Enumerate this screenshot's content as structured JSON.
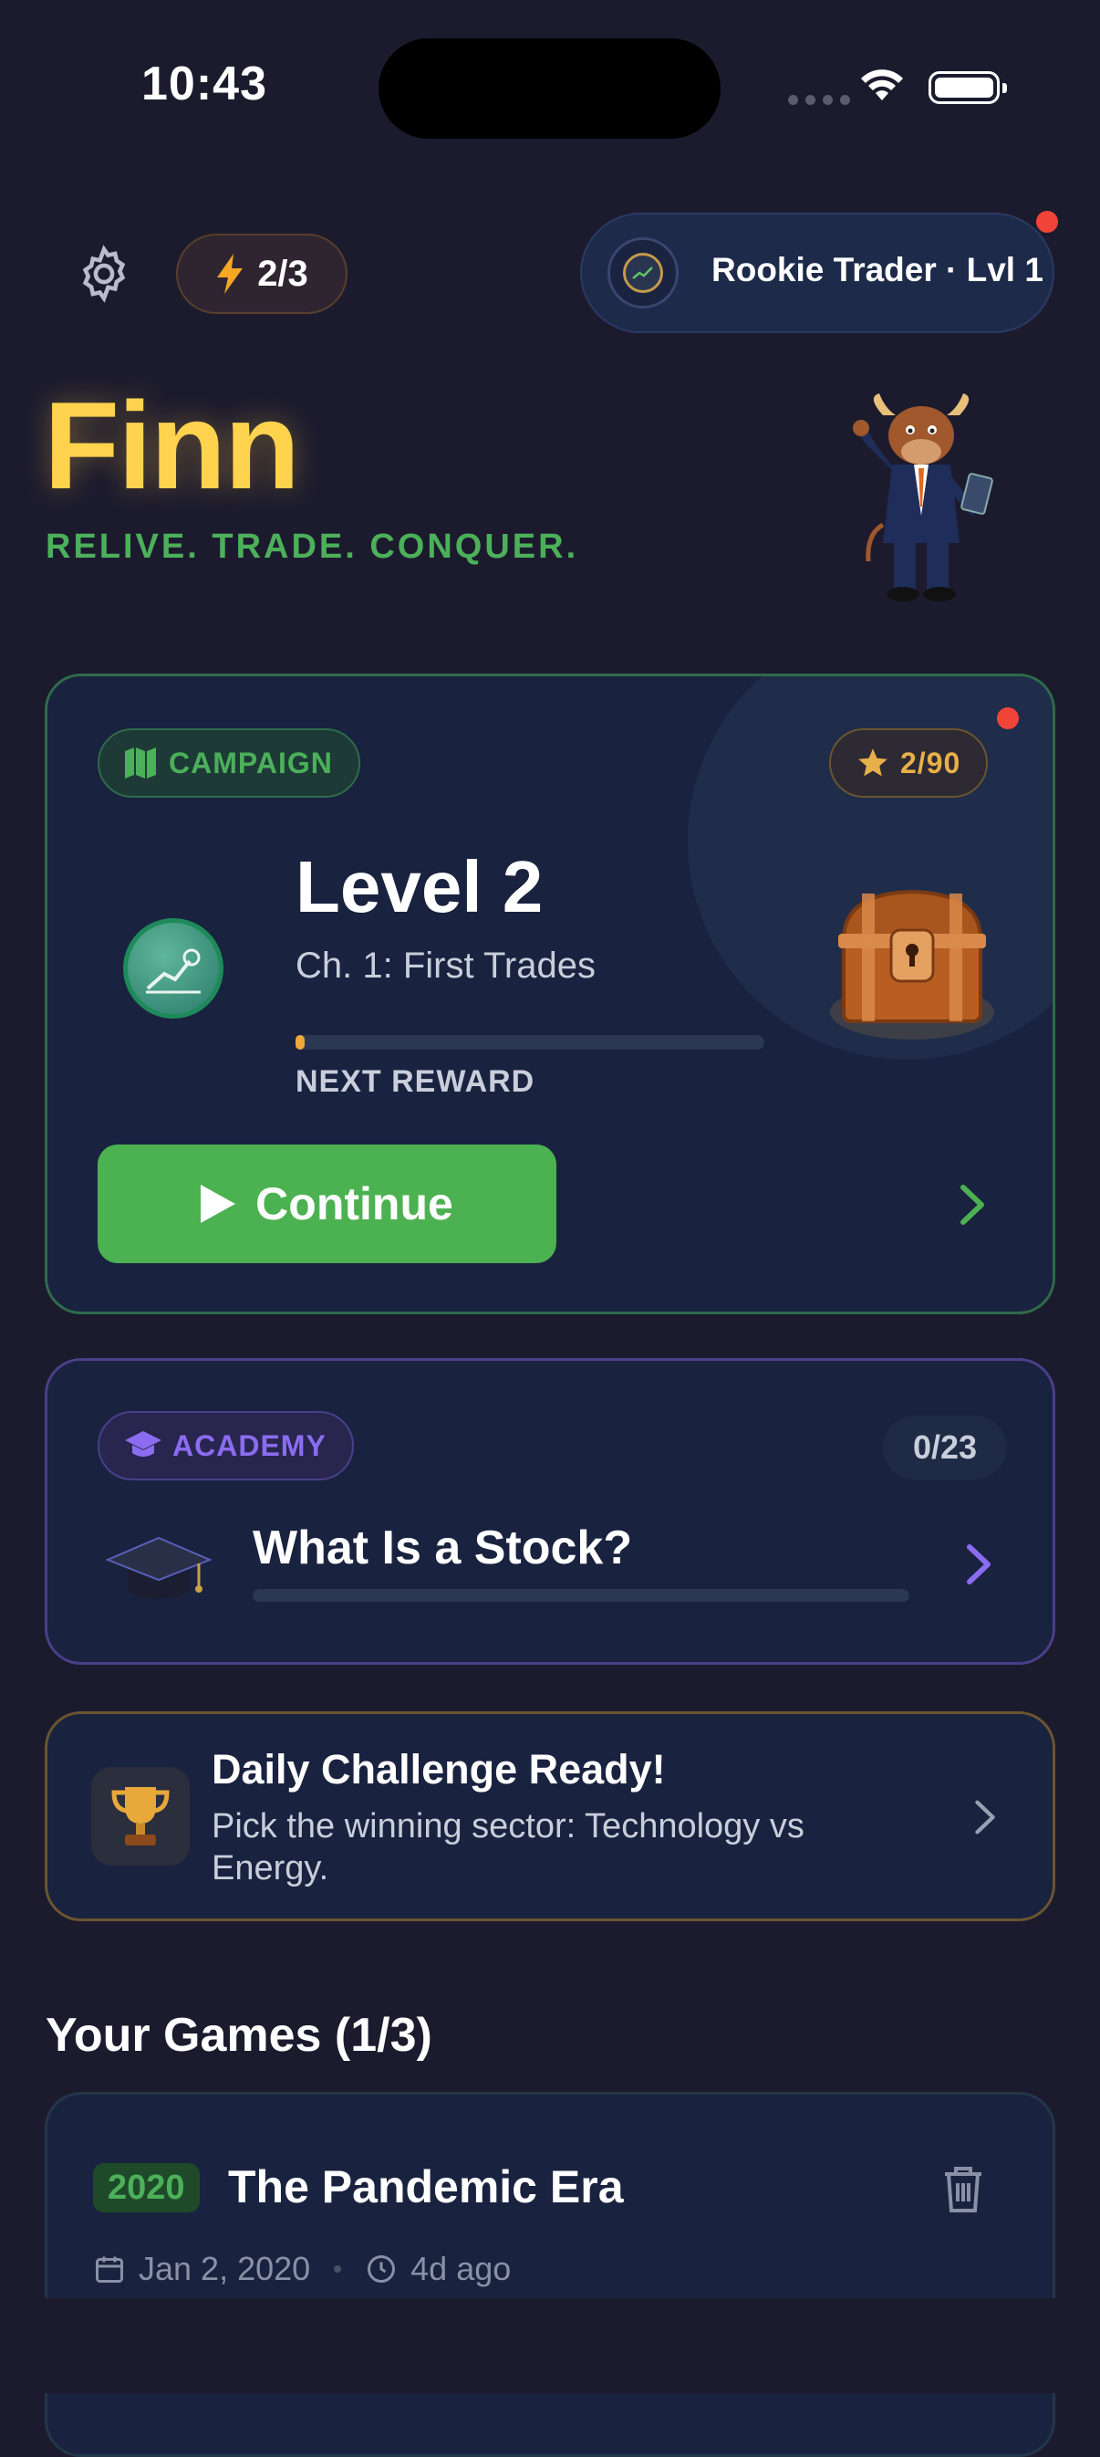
{
  "status_bar": {
    "time": "10:43"
  },
  "header": {
    "energy": "2/3",
    "rank_label": "Rookie Trader · Lvl 1"
  },
  "hero": {
    "title": "Finn",
    "tagline": "RELIVE. TRADE. CONQUER."
  },
  "campaign": {
    "chip_label": "CAMPAIGN",
    "stars": "2/90",
    "level": "Level 2",
    "chapter": "Ch. 1: First Trades",
    "progress_fraction": 0.02,
    "next_reward_label": "NEXT REWARD",
    "continue_label": "Continue"
  },
  "academy": {
    "chip_label": "ACADEMY",
    "count": "0/23",
    "lesson_title": "What Is a Stock?",
    "progress_fraction": 0
  },
  "daily_challenge": {
    "title": "Daily Challenge Ready!",
    "description": "Pick the winning sector: Technology vs Energy."
  },
  "games": {
    "section_title": "Your Games (1/3)",
    "items": [
      {
        "year": "2020",
        "title": "The Pandemic Era",
        "date": "Jan 2, 2020",
        "age": "4d ago"
      }
    ]
  },
  "colors": {
    "background": "#1c1b2e",
    "accent_green": "#4cb150",
    "accent_gold": "#ffd34d",
    "accent_purple": "#8b6cf0",
    "notification_red": "#f04438"
  },
  "icons": [
    "gear-icon",
    "lightning-icon",
    "rank-badge-icon",
    "map-icon",
    "star-icon",
    "play-icon",
    "chevron-right-icon",
    "graduation-cap-icon",
    "trophy-icon",
    "trash-icon",
    "calendar-icon",
    "clock-icon"
  ]
}
